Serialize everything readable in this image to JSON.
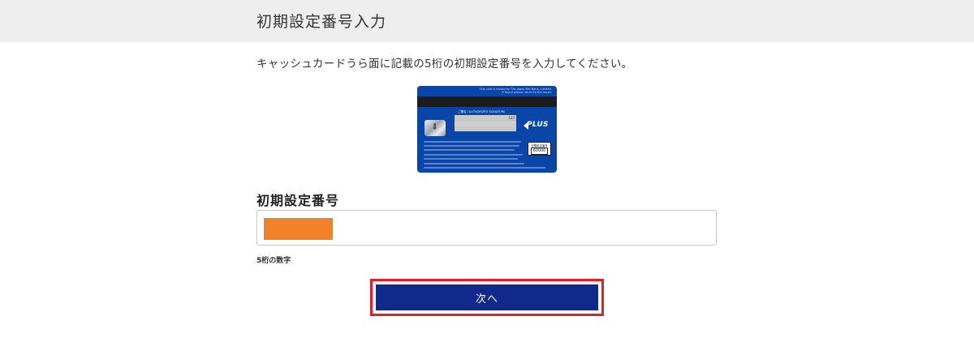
{
  "header": {
    "title": "初期設定番号入力"
  },
  "instruction": "キャッシュカードうら面に記載の5桁の初期設定番号を入力してください。",
  "card_image": {
    "issuer_text": "This card is issued by The Japan Net Bank, Limited.",
    "issuer_text_2": "If found please return to the issuer.",
    "signature_caption": "ご署名 / AUTHORIZED SIGNATURE",
    "signature_digits": "123",
    "brand": "PLUS",
    "code_label": "初期設定番号",
    "code_value": "60000",
    "card_color": "#0a46a8"
  },
  "form": {
    "label": "初期設定番号",
    "input_value": "",
    "redaction_color": "#f2822a",
    "helper_text": "5桁の数字"
  },
  "next_button": {
    "label": "次へ",
    "color": "#10298a",
    "highlight_color": "#e0202c"
  }
}
